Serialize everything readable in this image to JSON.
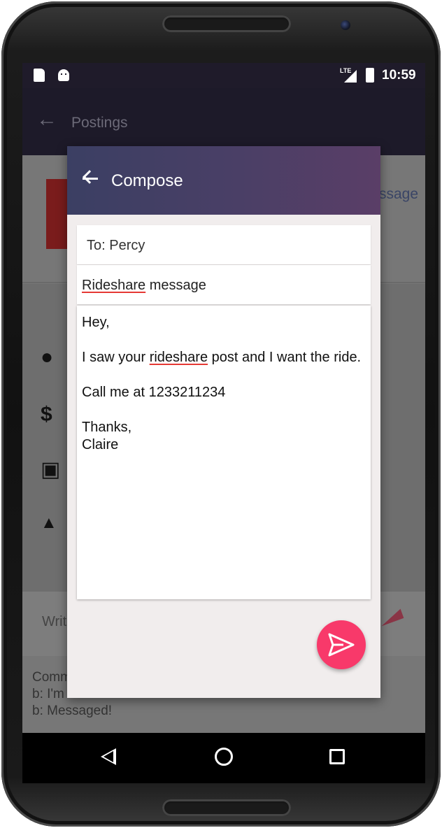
{
  "status_bar": {
    "network": "LTE",
    "time": "10:59"
  },
  "background": {
    "toolbar_title": "Postings",
    "message_link": "ssage",
    "write_placeholder": "Writ",
    "comments": [
      "Comm",
      "b: I'm",
      "b: Messaged!"
    ]
  },
  "dialog": {
    "title": "Compose",
    "to": "To: Percy",
    "subject_word": "Rideshare",
    "subject_rest": " message",
    "body": {
      "greeting": "Hey,",
      "line1_start": "I saw your ",
      "line1_word": "rideshare",
      "line1_end": " post and I want the ride.",
      "line2": "Call me at 1233211234",
      "signoff": "Thanks,",
      "name": "Claire"
    },
    "send_button_icon": "send-icon",
    "accent_color": "#f8396a"
  }
}
